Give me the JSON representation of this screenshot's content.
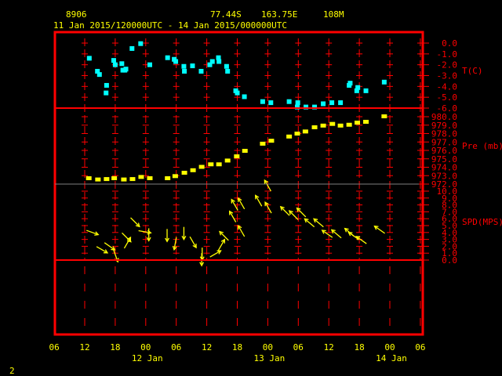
{
  "header": {
    "station_id": "8906",
    "latitude": "77.44S",
    "longitude": "163.75E",
    "elevation": "108M",
    "period": "11 Jan 2015/120000UTC - 14 Jan 2015/000000UTC"
  },
  "footer": {
    "page_number": "2"
  },
  "colors": {
    "axis": "#ff0000",
    "text": "#ffff00",
    "temperature": "#00ffff",
    "pressure": "#ffff00",
    "wind": "#ffff00",
    "divider": "#808080"
  },
  "chart_data": [
    {
      "type": "scatter",
      "title": "Temperature",
      "ylabel": "T(C)",
      "ylim": [
        -6,
        0
      ],
      "yticks": [
        "0.0",
        "-1.0",
        "-2.0",
        "-3.0",
        "-4.0",
        "-5.0",
        "-6.0"
      ],
      "x_unit": "hours since 11 Jan 2015 12UTC",
      "x": [
        0.9,
        2.5,
        2.9,
        4.3,
        4.2,
        5.7,
        6.0,
        7.3,
        7.5,
        8.1,
        7.9,
        9.3,
        11.0,
        12.8,
        16.3,
        17.6,
        17.9,
        19.5,
        19.6,
        21.2,
        22.9,
        24.6,
        25.1,
        26.3,
        26.4,
        27.9,
        28.1,
        29.7,
        30.0,
        31.4,
        35.0,
        36.6,
        40.2,
        41.8,
        41.9,
        43.5,
        45.2,
        46.9,
        48.6,
        50.3,
        52.0,
        52.2,
        53.7,
        53.5,
        55.3,
        58.9
      ],
      "y": [
        -1.4,
        -2.6,
        -2.9,
        -3.9,
        -4.6,
        -1.6,
        -2.0,
        -1.9,
        -2.5,
        -2.4,
        -2.5,
        -0.5,
        -0.05,
        -2.0,
        -1.35,
        -1.5,
        -1.7,
        -2.15,
        -2.6,
        -2.1,
        -2.6,
        -2.0,
        -1.7,
        -1.35,
        -1.7,
        -2.15,
        -2.6,
        -4.4,
        -4.6,
        -4.95,
        -5.4,
        -5.5,
        -5.4,
        -5.9,
        -5.5,
        -5.9,
        -5.9,
        -5.6,
        -5.5,
        -5.5,
        -3.9,
        -3.7,
        -4.1,
        -4.4,
        -4.4,
        -3.6
      ]
    },
    {
      "type": "scatter",
      "title": "Pressure",
      "ylabel": "Pre (mb)",
      "ylim": [
        972,
        980
      ],
      "yticks": [
        "980.0",
        "979.0",
        "978.0",
        "977.0",
        "976.0",
        "975.0",
        "974.0",
        "973.0",
        "972.0"
      ],
      "x_unit": "hours since 11 Jan 2015 12UTC",
      "x": [
        0.8,
        2.6,
        4.3,
        5.8,
        7.7,
        9.4,
        11.1,
        12.8,
        16.3,
        17.8,
        19.6,
        21.3,
        23.0,
        24.8,
        26.4,
        28.1,
        29.9,
        31.5,
        35.0,
        36.7,
        40.2,
        41.8,
        43.4,
        45.2,
        46.9,
        48.7,
        50.3,
        52.0,
        53.6,
        55.3,
        58.9
      ],
      "y": [
        972.65,
        972.5,
        972.55,
        972.65,
        972.5,
        972.55,
        972.8,
        972.65,
        972.65,
        972.9,
        973.3,
        973.6,
        974.0,
        974.3,
        974.3,
        974.75,
        975.25,
        975.9,
        976.75,
        977.1,
        977.6,
        977.95,
        978.2,
        978.7,
        978.9,
        979.1,
        978.9,
        979.0,
        979.25,
        979.35,
        980.0
      ]
    },
    {
      "type": "scatter",
      "title": "Wind speed and direction",
      "ylabel": "SPD(MPS)",
      "ylim": [
        0,
        10
      ],
      "yticks": [
        "10.0",
        "9.0",
        "8.0",
        "7.0",
        "6.0",
        "5.0",
        "4.0",
        "3.0",
        "2.0",
        "1.0",
        "0.0"
      ],
      "x_unit": "hours since 11 Jan 2015 12UTC",
      "x": [
        1.5,
        3.4,
        4.9,
        6.1,
        9.9,
        8.2,
        8.4,
        11.8,
        12.6,
        16.2,
        17.8,
        19.5,
        21.3,
        23.1,
        23.0,
        25.7,
        26.9,
        27.4,
        29.1,
        29.5,
        30.8,
        30.8,
        34.2,
        36.0,
        36.1,
        39.4,
        41.1,
        42.6,
        44.2,
        46.0,
        47.7,
        49.5,
        52.1,
        52.9,
        54.4,
        58.0
      ],
      "y": [
        4.0,
        1.5,
        2.0,
        0.6,
        5.5,
        3.3,
        2.5,
        4.1,
        3.7,
        3.6,
        2.4,
        3.9,
        2.6,
        0.9,
        0.1,
        0.9,
        2.2,
        3.5,
        6.3,
        8.0,
        8.2,
        4.2,
        8.6,
        10.8,
        7.6,
        7.1,
        6.5,
        6.9,
        5.4,
        5.4,
        3.8,
        3.8,
        4.0,
        3.5,
        2.9,
        4.4
      ],
      "arrow_screen_angle_deg": [
        20,
        30,
        35,
        70,
        45,
        45,
        -60,
        10,
        90,
        90,
        100,
        90,
        60,
        90,
        90,
        -30,
        -60,
        -135,
        -120,
        -120,
        -120,
        -120,
        -120,
        -120,
        -120,
        -135,
        -135,
        -135,
        -140,
        -140,
        -145,
        -140,
        -140,
        -145,
        -145,
        -145
      ]
    }
  ],
  "x_axis": {
    "hour_labels": [
      "06",
      "12",
      "18",
      "00",
      "06",
      "12",
      "18",
      "00",
      "06",
      "12",
      "18",
      "00",
      "06"
    ],
    "day_labels": [
      "12 Jan",
      "13 Jan",
      "14 Jan"
    ]
  }
}
